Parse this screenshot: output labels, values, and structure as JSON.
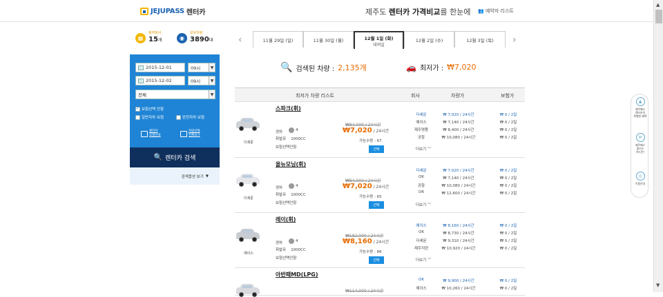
{
  "header": {
    "logo_text": "JEJUPASS",
    "logo_text2": "렌터카",
    "tagline_pre": "제주도 ",
    "tagline_bold": "렌터카 가격비교",
    "tagline_post": "를 한눈에",
    "reservation_link": "예약자 리스트"
  },
  "stats": {
    "companies_label": "참여회사",
    "companies_value": "15",
    "companies_unit": "개",
    "cars_label": "보유차량",
    "cars_value": "3890",
    "cars_unit": "대"
  },
  "search": {
    "start_date": "2015-12-01",
    "start_time": "09시",
    "end_date": "2015-12-02",
    "end_time": "09시",
    "car_type": "전체",
    "checks": [
      {
        "label": "보험선택 안함",
        "checked": true
      },
      {
        "label": "일반자차 보험",
        "checked": false
      },
      {
        "label": "완전자차 보험",
        "checked": false
      }
    ],
    "guide1_line1": "렌터카",
    "guide1_line2": "요청안내",
    "guide2_line1": "차량선택",
    "guide2_line2": "전체보기",
    "button_label": "렌터카 검색",
    "options_label": "검색옵션 보기"
  },
  "dates": [
    {
      "label": "11월 29일 (일)",
      "sub": "",
      "active": false
    },
    {
      "label": "11월 30일 (월)",
      "sub": "",
      "active": false
    },
    {
      "label": "12월 1일 (화)",
      "sub": "대여일",
      "active": true
    },
    {
      "label": "12월 2일 (수)",
      "sub": "",
      "active": false
    },
    {
      "label": "12월 3일 (목)",
      "sub": "",
      "active": false
    }
  ],
  "summary": {
    "found_label": "검색된 차량 : ",
    "found_value": "2,135개",
    "lowest_label": "최저가 : ",
    "lowest_value": "₩7,020"
  },
  "table_header": {
    "col1": "최저가 차량 리스트",
    "col2": "회사",
    "col3": "차량가",
    "col4": "보험가"
  },
  "cars": [
    {
      "name": "스파크(휘)",
      "brand": "더셰문",
      "color": "#cfd3d8",
      "class": "경차",
      "seats": "4",
      "fuel": "휘발유",
      "cc": "1000CC",
      "insurance": "보험선택안함",
      "old_price": "₩84,000 / 24시간",
      "price": "₩7,020",
      "per": " / 24시간",
      "avail": "가능수량 : 67",
      "select": "선택",
      "offers": [
        {
          "co": "더셰문",
          "pr": "₩ 7,020 / 24시간",
          "ins": "₩ 0 / 2일",
          "blue": true
        },
        {
          "co": "예이스",
          "pr": "₩ 7,140 / 24시간",
          "ins": "₩ 0 / 2일",
          "blue": false
        },
        {
          "co": "제주명품",
          "pr": "₩ 8,400 / 24시간",
          "ins": "₩ 0 / 2일",
          "blue": false
        },
        {
          "co": "공항",
          "pr": "₩ 10,080 / 24시간",
          "ins": "₩ 0 / 2일",
          "blue": false
        }
      ],
      "more": "더보기"
    },
    {
      "name": "올뉴모닝(휘)",
      "brand": "더셰문",
      "color": "#e6e7ea",
      "class": "경차",
      "seats": "4",
      "fuel": "휘발유",
      "cc": "1000CC",
      "insurance": "보험선택안함",
      "old_price": "₩84,000 / 24시간",
      "price": "₩7,020",
      "per": " / 24시간",
      "avail": "가능수량 : 65",
      "select": "선택",
      "offers": [
        {
          "co": "더셰문",
          "pr": "₩ 7,020 / 24시간",
          "ins": "₩ 0 / 2일",
          "blue": true
        },
        {
          "co": "OK",
          "pr": "₩ 7,140 / 24시간",
          "ins": "₩ 0 / 2일",
          "blue": false
        },
        {
          "co": "공항",
          "pr": "₩ 10,080 / 24시간",
          "ins": "₩ 0 / 2일",
          "blue": false
        },
        {
          "co": "DR",
          "pr": "₩ 12,600 / 24시간",
          "ins": "₩ 0 / 2일",
          "blue": false
        }
      ],
      "more": "더보기"
    },
    {
      "name": "레이(휘)",
      "brand": "예이스",
      "color": "#c9ccd1",
      "class": "경차",
      "seats": "4",
      "fuel": "휘발유",
      "cc": "1000CC",
      "insurance": "보험선택안함",
      "old_price": "₩182,000 / 24시간",
      "price": "₩8,160",
      "per": " / 24시간",
      "avail": "가능수량 : 86",
      "select": "선택",
      "offers": [
        {
          "co": "예이스",
          "pr": "₩ 8,160 / 24시간",
          "ins": "₩ 0 / 2일",
          "blue": true
        },
        {
          "co": "OK",
          "pr": "₩ 8,730 / 24시간",
          "ins": "₩ 0 / 2일",
          "blue": false
        },
        {
          "co": "더셰문",
          "pr": "₩ 9,310 / 24시간",
          "ins": "₩ 0 / 2일",
          "blue": false
        },
        {
          "co": "제주저련",
          "pr": "₩ 10,920 / 24시간",
          "ins": "₩ 0 / 2일",
          "blue": false
        }
      ],
      "more": "더보기"
    },
    {
      "name": "아반떼MD(LPG)",
      "brand": "",
      "color": "#d8dade",
      "class": "",
      "seats": "",
      "fuel": "",
      "cc": "",
      "insurance": "",
      "old_price": "₩114,000 / 24시간",
      "price": "",
      "per": "",
      "avail": "",
      "select": "",
      "offers": [
        {
          "co": "OK",
          "pr": "₩ 9,900 / 24시간",
          "ins": "₩ 0 / 2일",
          "blue": true
        },
        {
          "co": "예이스",
          "pr": "₩ 10,260 / 24시간",
          "ins": "₩ 0 / 2일",
          "blue": false
        }
      ],
      "more": ""
    }
  ],
  "widgets": [
    {
      "l1": "제주패스",
      "l2": "렌터카의",
      "l3": "특별한 혜택",
      "icon": "▲"
    },
    {
      "l1": "제주패스",
      "l2": "플러스",
      "l3": "카드란?",
      "icon": "✉"
    },
    {
      "l1": "이용안내",
      "l2": "",
      "l3": "",
      "icon": "◎"
    }
  ]
}
